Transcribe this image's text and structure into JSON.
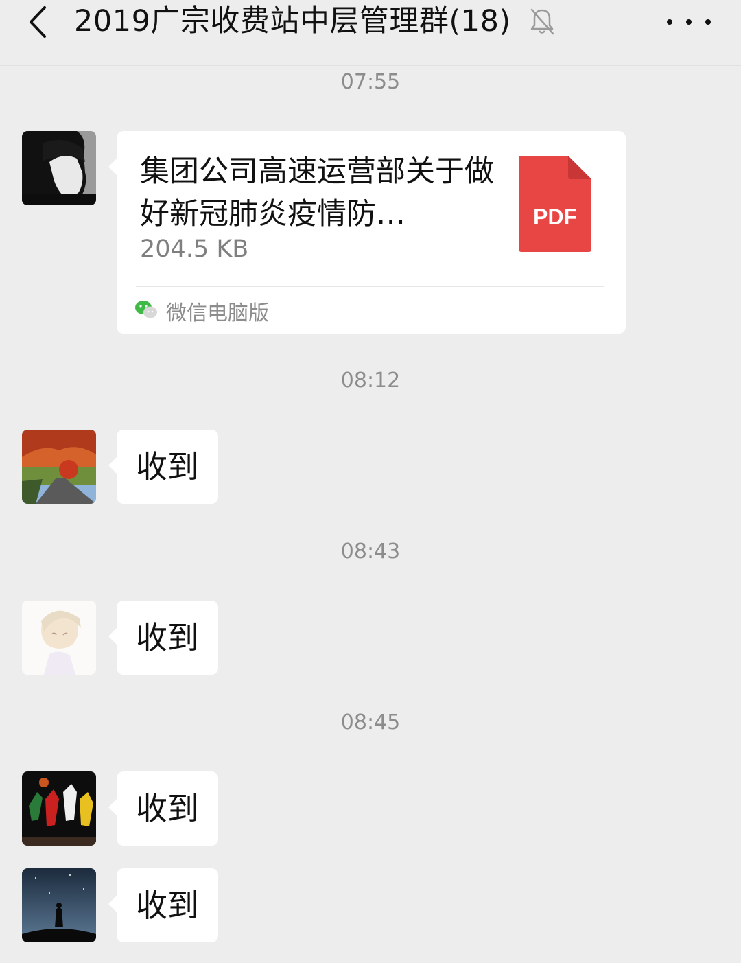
{
  "header": {
    "title": "2019广宗收费站中层管理群(18)",
    "back_icon": "chevron-left-icon",
    "mute_icon": "bell-muted-icon",
    "more_icon": "more-dots-icon"
  },
  "messages": [
    {
      "time": "07:55",
      "type": "file",
      "file_title": "集团公司高速运营部关于做好新冠肺炎疫情防…",
      "file_size": "204.5 KB",
      "file_badge": "PDF",
      "source": "微信电脑版"
    },
    {
      "time": "08:12",
      "type": "text",
      "text": "收到"
    },
    {
      "time": "08:43",
      "type": "text",
      "text": "收到"
    },
    {
      "time": "08:45",
      "type": "text",
      "text": "收到"
    },
    {
      "type": "text",
      "text": "收到"
    }
  ],
  "colors": {
    "background": "#ededed",
    "bubble": "#ffffff",
    "pdf_red": "#e84545",
    "wechat_green": "#3fba46"
  }
}
